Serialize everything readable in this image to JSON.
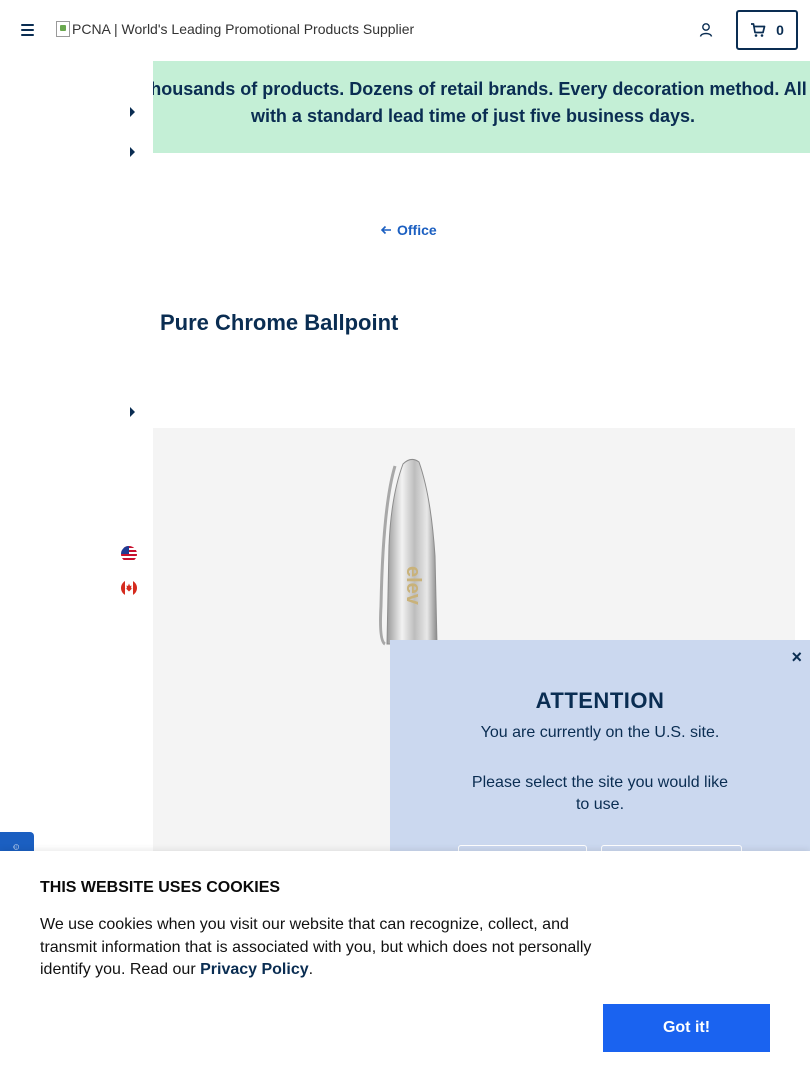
{
  "header": {
    "logo_alt": "PCNA | World's Leading Promotional Products Supplier",
    "cart_count": "0"
  },
  "banner": {
    "text": "Thousands of products. Dozens of retail brands. Every decoration method. All with a standard lead time of just five business days."
  },
  "breadcrumb": {
    "label": "Office"
  },
  "product": {
    "title": "Pure Chrome Ballpoint"
  },
  "modal": {
    "close_label": "×",
    "title": "ATTENTION",
    "message": "You are currently on the U.S. site.",
    "prompt": "Please select the site you would like to use."
  },
  "cookie": {
    "title": "THIS WEBSITE USES COOKIES",
    "text": "We use cookies when you visit our website that can recognize, collect, and transmit information that is associated with you, but which does not personally identify you. Read our ",
    "link": "Privacy Policy",
    "period": ".",
    "button": "Got it!"
  },
  "colors": {
    "brand_navy": "#0a2d52",
    "banner_green": "#c4efd6",
    "accent_blue": "#1a63f0",
    "modal_bg": "#cbd8ef"
  },
  "icons": {
    "menu": "hamburger-icon",
    "account": "user-icon",
    "cart": "cart-icon",
    "back": "arrow-left-icon",
    "close": "close-icon"
  }
}
